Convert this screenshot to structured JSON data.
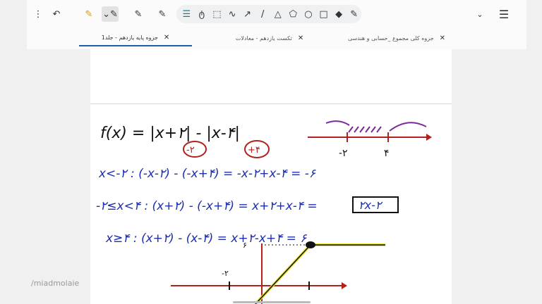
{
  "toolbar": {
    "tools": [
      "more-vertical-icon",
      "undo-icon",
      "highlighter-yellow-icon",
      "pen-dropdown-icon",
      "pen-icon",
      "pen-icon",
      "settings-sliders-icon",
      "lasso-icon",
      "select-rect-icon",
      "freehand-line-icon",
      "arrow-icon",
      "line-icon",
      "cloud-icon",
      "pentagon-icon",
      "circle-icon",
      "square-icon",
      "eraser-icon",
      "pen-icon"
    ],
    "dropdown": "⌄",
    "menu": "☰"
  },
  "tabs": [
    {
      "label": "جزوه پایه یازدهم - جلد1",
      "active": true
    },
    {
      "label": "تکست یازدهم - معادلات",
      "active": false
    },
    {
      "label": "جزوه کلی مجموع _حسابی و هندسی",
      "active": false
    }
  ],
  "notes": {
    "line1": "f(x) = |x+۲| - |x-۴|",
    "root1": "-۲",
    "root2": "+۴",
    "axis_l": "-۲",
    "axis_r": "۴",
    "line2": "x<-۲ : (-x-۲) - (-x+۴) = -x-۲+x-۴ = -۶",
    "line3": "-۲≤x<۴ : (x+۲) - (-x+۴) = x+۲+x-۴ =",
    "line3_box": "۲x-۲",
    "line4": "x≥۴ : (x+۲) - (x-۴) = x+۲-x+۴ = ۶",
    "graph_y": "۶",
    "graph_neg": "-۲"
  },
  "watermark": "/miadmolaie",
  "colors": {
    "ink_black": "#111111",
    "ink_blue": "#1c2fb0",
    "ink_red": "#b0201c",
    "ink_purple": "#7a2a9a",
    "highlight": "#e8e020",
    "tab_accent": "#1f5fa8"
  }
}
